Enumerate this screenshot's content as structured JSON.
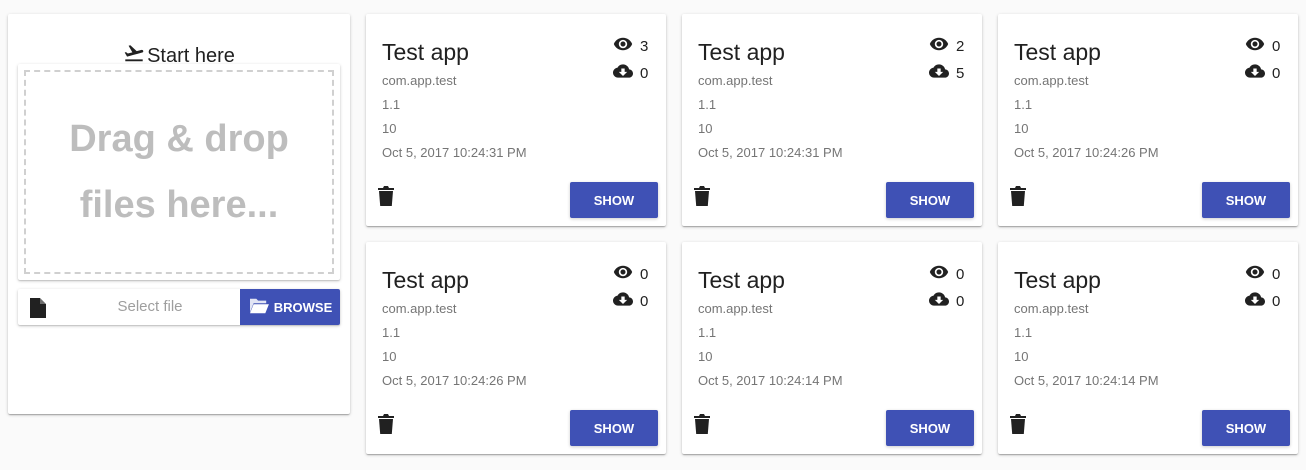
{
  "upload": {
    "title": "Start here",
    "dropzone_text": "Drag & drop files here...",
    "file_placeholder": "Select file",
    "browse_label": "BROWSE"
  },
  "apps": [
    {
      "title": "Test app",
      "package": "com.app.test",
      "version": "1.1",
      "build": "10",
      "date": "Oct 5, 2017 10:24:31 PM",
      "views": "3",
      "downloads": "0",
      "show_label": "SHOW"
    },
    {
      "title": "Test app",
      "package": "com.app.test",
      "version": "1.1",
      "build": "10",
      "date": "Oct 5, 2017 10:24:31 PM",
      "views": "2",
      "downloads": "5",
      "show_label": "SHOW"
    },
    {
      "title": "Test app",
      "package": "com.app.test",
      "version": "1.1",
      "build": "10",
      "date": "Oct 5, 2017 10:24:26 PM",
      "views": "0",
      "downloads": "0",
      "show_label": "SHOW"
    },
    {
      "title": "Test app",
      "package": "com.app.test",
      "version": "1.1",
      "build": "10",
      "date": "Oct 5, 2017 10:24:26 PM",
      "views": "0",
      "downloads": "0",
      "show_label": "SHOW"
    },
    {
      "title": "Test app",
      "package": "com.app.test",
      "version": "1.1",
      "build": "10",
      "date": "Oct 5, 2017 10:24:14 PM",
      "views": "0",
      "downloads": "0",
      "show_label": "SHOW"
    },
    {
      "title": "Test app",
      "package": "com.app.test",
      "version": "1.1",
      "build": "10",
      "date": "Oct 5, 2017 10:24:14 PM",
      "views": "0",
      "downloads": "0",
      "show_label": "SHOW"
    }
  ],
  "colors": {
    "accent": "#3f51b5"
  },
  "icons": {
    "title": "flight-takeoff-icon",
    "file": "file-icon",
    "browse": "folder-open-icon",
    "views": "eye-icon",
    "downloads": "cloud-download-icon",
    "delete": "trash-icon"
  }
}
